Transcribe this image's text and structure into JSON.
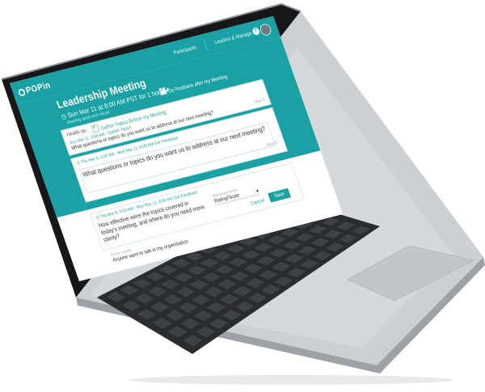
{
  "app": {
    "logo": "POPin"
  },
  "nav": {
    "item1": "Participants",
    "item2": "Leaders & Manage",
    "help": "?"
  },
  "meeting": {
    "title": "Leadership Meeting",
    "date_line": "Sun Mar 11 at 8:00 AM PST for 1 hour",
    "sub_line": "Meeting quick and robust",
    "facebook_option": "Do Postback after my Meeting"
  },
  "sections": [
    {
      "label": "Heads up:",
      "checkbox_label": "Gather Topics Before my Meeting",
      "timing": "Sun Mar 11, 3:00 AM - Gather Topics",
      "question": "What questions or topics do you want us to address at our next meeting?",
      "char_note": "Max 5"
    },
    {
      "timing": "Thu Mar 8, 3:00 AM - Mon Mar 12, 8:00 AM Get Feedback",
      "question": "What questions or topics do you want us to address at our next meeting?",
      "char_note": "Max 5"
    },
    {
      "timing": "Thu Mar 8, 3:00 AM - Mon Mar 12, 8:00 AM Get Feedback",
      "question": "How effective were the topics covered in today's meeting, and where do you need more clarity?",
      "answer_label": "Answering format",
      "answer_value": "Rating/Scale",
      "cancel": "Cancel",
      "save": "Save"
    }
  ],
  "footer": {
    "label": "Interim rounds",
    "text": "Anyone want to talk in my organisation"
  },
  "colors": {
    "brand": "#1aa1a3",
    "panel_light": "#d6f2f3"
  }
}
